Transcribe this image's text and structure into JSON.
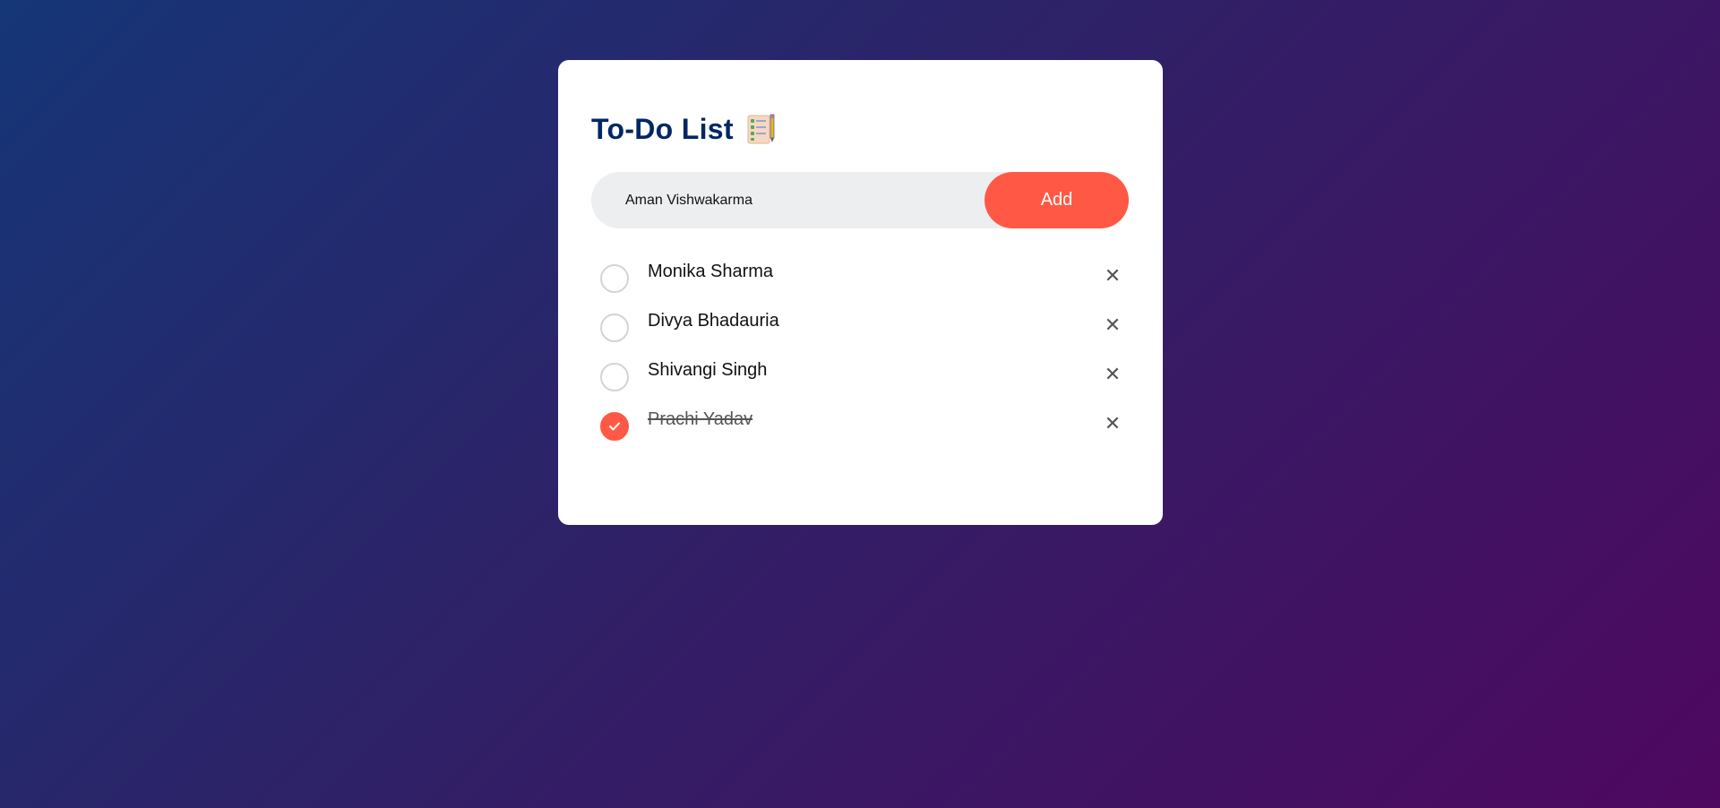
{
  "app": {
    "title": "To-Do List",
    "title_icon": "notepad-checklist-icon"
  },
  "input": {
    "value": "Aman Vishwakarma",
    "add_label": "Add"
  },
  "todos": [
    {
      "text": "Monika Sharma",
      "done": false,
      "remove_label": "✕"
    },
    {
      "text": "Divya Bhadauria",
      "done": false,
      "remove_label": "✕"
    },
    {
      "text": "Shivangi Singh",
      "done": false,
      "remove_label": "✕"
    },
    {
      "text": "Prachi Yadav",
      "done": true,
      "remove_label": "✕"
    }
  ],
  "colors": {
    "accent": "#ff5945",
    "title": "#002765",
    "gradient_start": "#153677",
    "gradient_end": "#4e085f"
  }
}
